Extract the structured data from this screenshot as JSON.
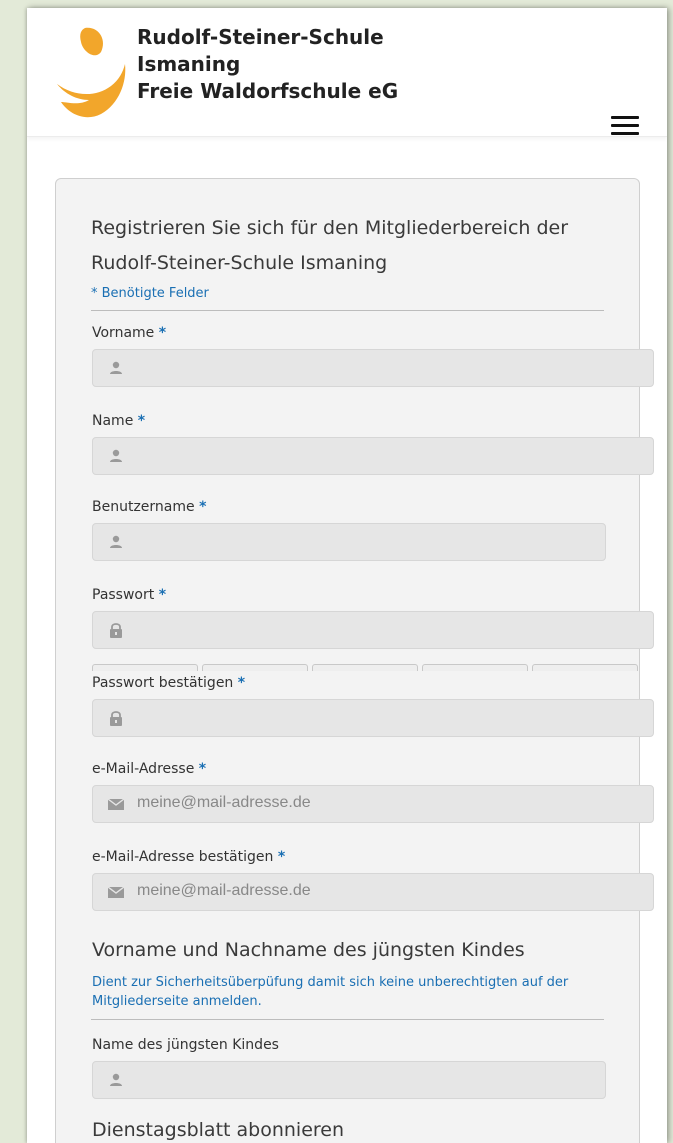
{
  "header": {
    "title_lines": [
      "Rudolf-Steiner-Schule",
      "Ismaning",
      "Freie Waldorfschule eG"
    ],
    "logo_icon": "school-logo",
    "menu_icon": "hamburger-menu-icon"
  },
  "form": {
    "heading": "Registrieren Sie sich für den Mitgliederbereich der Rudolf-Steiner-Schule Ismaning",
    "required_note": "* Benötigte Felder",
    "required_marker": "*",
    "fields": [
      {
        "label": "Vorname",
        "icon": "user-icon",
        "value": ""
      },
      {
        "label": "Name",
        "icon": "user-icon",
        "value": ""
      },
      {
        "label": "Benutzername",
        "icon": "user-icon",
        "value": ""
      },
      {
        "label": "Passwort",
        "icon": "lock-icon",
        "value": ""
      },
      {
        "label": "Passwort bestätigen",
        "icon": "lock-icon",
        "value": ""
      },
      {
        "label": "e-Mail-Adresse",
        "icon": "mail-icon",
        "value": "",
        "placeholder": "meine@mail-adresse.de"
      },
      {
        "label": "e-Mail-Adresse bestätigen",
        "icon": "mail-icon",
        "value": "",
        "placeholder": "meine@mail-adresse.de"
      }
    ],
    "child_section": {
      "heading": "Vorname und Nachname des jüngsten Kindes",
      "help": "Dient zur Sicherheitsüberpüfung damit sich keine unberechtigten auf der Mitgliederseite anmelden.",
      "field_label": "Name des jüngsten Kindes",
      "field_icon": "user-icon",
      "field_value": ""
    },
    "next_section_heading": "Dienstagsblatt abonnieren"
  },
  "colors": {
    "accent": "#1a6fb3",
    "logo_orange": "#f2a62b",
    "page_bg": "#e3ead8"
  }
}
